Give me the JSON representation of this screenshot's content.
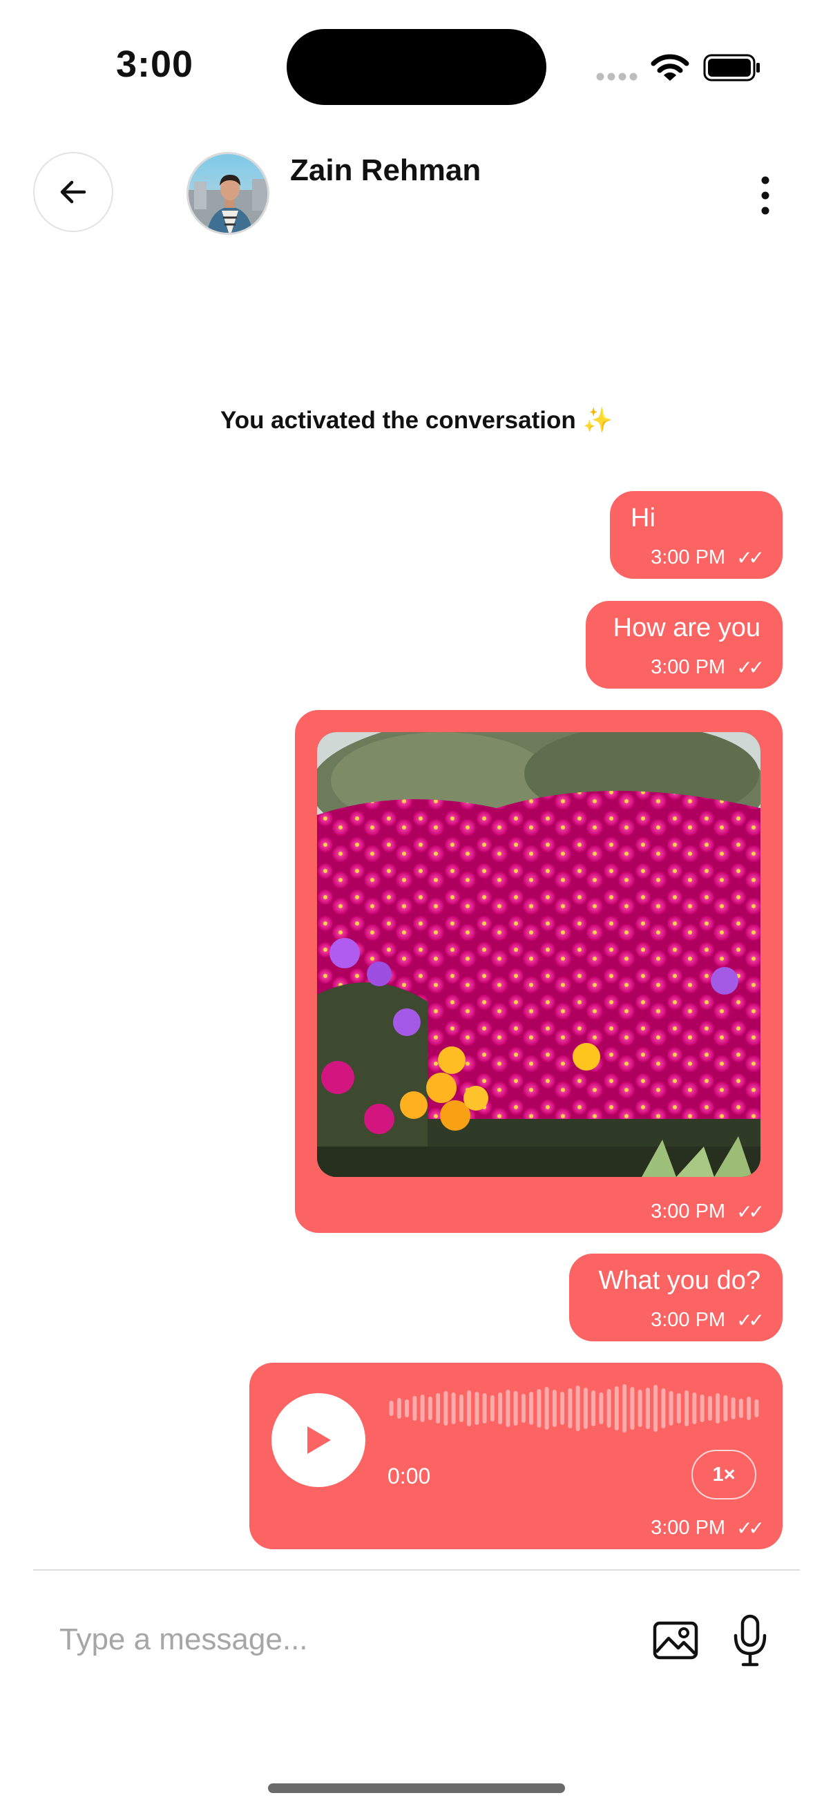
{
  "status_bar": {
    "time": "3:00"
  },
  "header": {
    "contact_name": "Zain Rehman",
    "back_icon": "arrow-left-icon",
    "more_icon": "more-vertical-icon"
  },
  "system_message": "You activated the conversation ✨",
  "messages": [
    {
      "type": "text",
      "text": "Hi",
      "time": "3:00 PM",
      "status": "✓✓"
    },
    {
      "type": "text",
      "text": "How are you",
      "time": "3:00 PM",
      "status": "✓✓"
    },
    {
      "type": "image",
      "image": "magenta-flowers-photo",
      "time": "3:00 PM",
      "status": "✓✓"
    },
    {
      "type": "text",
      "text": "What you do?",
      "time": "3:00 PM",
      "status": "✓✓"
    },
    {
      "type": "audio",
      "duration": "0:00",
      "speed": "1×",
      "time": "3:00 PM",
      "status": "✓✓"
    }
  ],
  "composer": {
    "placeholder": "Type a message...",
    "image_icon": "image-icon",
    "mic_icon": "microphone-icon"
  },
  "colors": {
    "bubble": "#fc6464",
    "text": "#111111",
    "placeholder": "#a6a6a6"
  }
}
